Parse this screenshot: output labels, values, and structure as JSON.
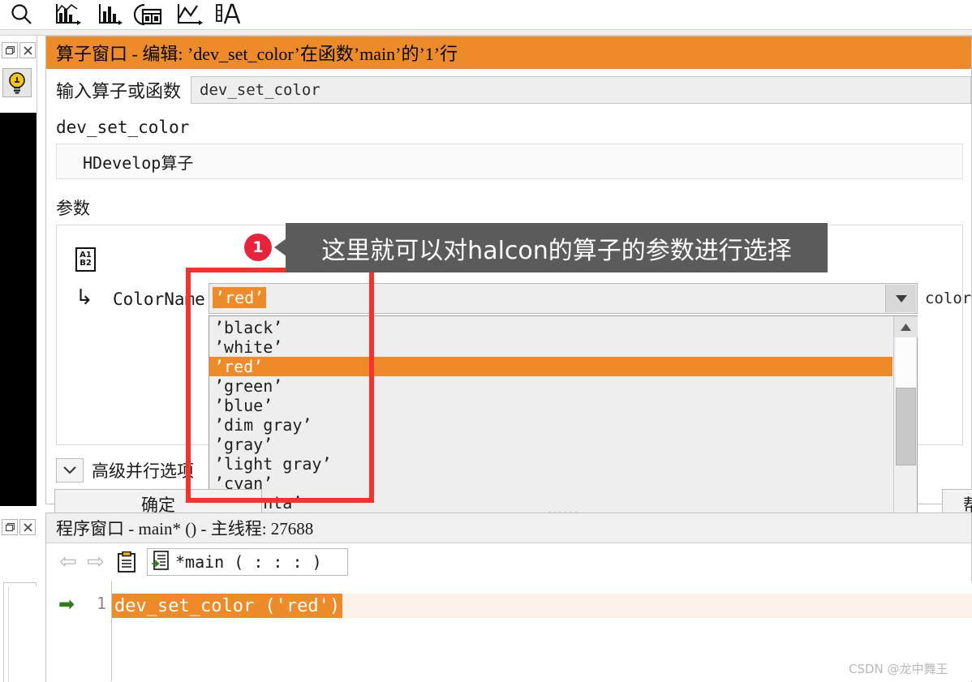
{
  "toolbar": {
    "icons": [
      {
        "name": "search-icon",
        "label": "搜索"
      },
      {
        "name": "feature-histogram-icon",
        "label": "特征直方图"
      },
      {
        "name": "histogram-icon",
        "label": "直方图"
      },
      {
        "name": "feature-table-icon",
        "label": "特征表"
      },
      {
        "name": "line-chart-icon",
        "label": "曲线图"
      },
      {
        "name": "text-font-icon",
        "label": "文本"
      }
    ]
  },
  "left_dock": {
    "top_panel": {
      "restore_label": "❐",
      "close_label": "✕",
      "lamp_label": "提示"
    },
    "bottom_panel": {
      "restore_label": "❐",
      "close_label": "✕"
    }
  },
  "operator_window": {
    "title": "算子窗口 - 编辑: ’dev_set_color’在函数’main’的’1’行",
    "input_label": "输入算子或函数",
    "input_value": "dev_set_color",
    "operator_name": "dev_set_color",
    "operator_description": "HDevelop算子",
    "params_section_label": "参数",
    "param": {
      "icon_line1": "A1",
      "icon_line2": "B2",
      "branch_glyph": "↳",
      "name": "ColorName",
      "type_hint": "color",
      "selected_value": "’red’",
      "dropdown_arrow": "▼",
      "options": [
        "’black’",
        "’white’",
        "’red’",
        "’green’",
        "’blue’",
        "’dim gray’",
        "’gray’",
        "’light gray’",
        "’cyan’",
        "’magenta’"
      ],
      "selected_index": 2
    },
    "scrollbar": {
      "up_glyph": "▲",
      "down_glyph": "▼"
    },
    "advanced_label": "高级并行选项",
    "advanced_chevron": "⌄",
    "ok_button": "确定",
    "help_button": "帮助",
    "splitter_dots": "......"
  },
  "program_window": {
    "title": "程序窗口 - main* () - 主线程: 27688",
    "nav_back": "⇦",
    "nav_forward": "⇨",
    "clipboard_icon": "clipboard",
    "procedure_icon": "procedure",
    "procedure_text": "*main ( : : : )",
    "code": {
      "marker": "➡",
      "line_number": "1",
      "line_text": "dev_set_color ('red')"
    }
  },
  "annotation": {
    "badge": "1",
    "text": "这里就可以对halcon的算子的参数进行选择",
    "highlight_color": "#f8312f",
    "callout_color": "#5b5b5b",
    "badge_color": "#e8243c"
  },
  "watermark": "CSDN @龙中舞王"
}
